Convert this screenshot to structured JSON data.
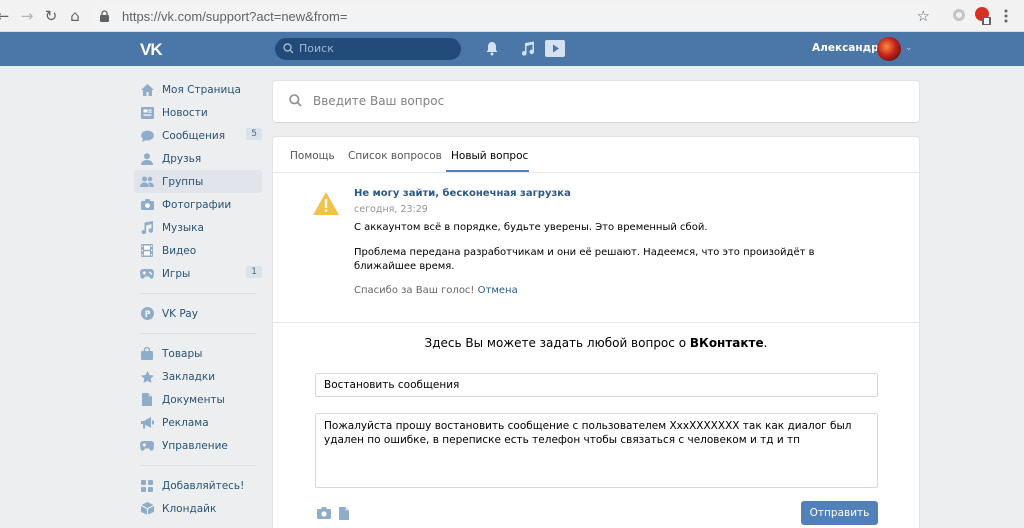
{
  "browser": {
    "url": "https://vk.com/support?act=new&from="
  },
  "header": {
    "logo": "VK",
    "search_placeholder": "Поиск",
    "user_name": "Александра"
  },
  "menu": {
    "items": [
      {
        "label": "Моя Страница",
        "badge": ""
      },
      {
        "label": "Новости",
        "badge": ""
      },
      {
        "label": "Сообщения",
        "badge": "5"
      },
      {
        "label": "Друзья",
        "badge": ""
      },
      {
        "label": "Группы",
        "badge": ""
      },
      {
        "label": "Фотографии",
        "badge": ""
      },
      {
        "label": "Музыка",
        "badge": ""
      },
      {
        "label": "Видео",
        "badge": ""
      },
      {
        "label": "Игры",
        "badge": "1"
      }
    ],
    "pay": {
      "label": "VK Pay"
    },
    "extra": [
      {
        "label": "Товары"
      },
      {
        "label": "Закладки"
      },
      {
        "label": "Документы"
      },
      {
        "label": "Реклама"
      },
      {
        "label": "Управление"
      }
    ],
    "bottom": [
      {
        "label": "Добавляйтесь!"
      },
      {
        "label": "Клондайк"
      }
    ]
  },
  "question_search": {
    "placeholder": "Введите Ваш вопрос"
  },
  "tabs": [
    "Помощь",
    "Список вопросов",
    "Новый вопрос"
  ],
  "notice": {
    "title": "Не могу зайти, бесконечная загрузка",
    "time": "сегодня, 23:29",
    "p1": "С аккаунтом всё в порядке, будьте уверены. Это временный сбой.",
    "p2": "Проблема передана разработчикам и они её решают. Надеемся, что это произойдёт в ближайшее время.",
    "thanks": "Спасибо за Ваш голос!",
    "cancel": "Отмена"
  },
  "ask": {
    "lead": "Здесь Вы можете задать любой вопрос о",
    "brand": "ВКонтакте",
    "end": ".",
    "subject_value": "Востановить сообщения",
    "body_value": "Пожалуйста прошу востановить сообщение с пользователем XxxXXXXXXX так как диалог был удален по ошибке, в переписке есть телефон чтобы связаться с человеком  и тд и тп",
    "send_label": "Отправить"
  }
}
